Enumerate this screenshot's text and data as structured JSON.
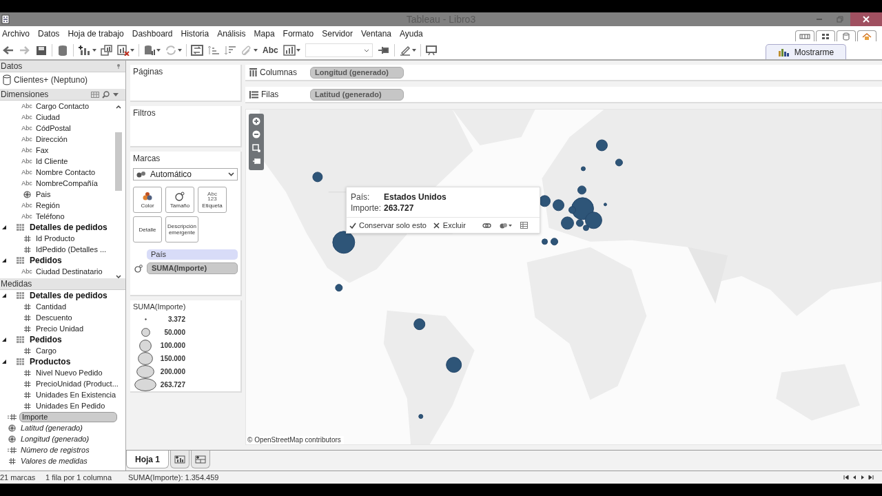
{
  "window": {
    "title": "Tableau - Libro3"
  },
  "menu": [
    "Archivo",
    "Datos",
    "Hoja de trabajo",
    "Dashboard",
    "Historia",
    "Análisis",
    "Mapa",
    "Formato",
    "Servidor",
    "Ventana",
    "Ayuda"
  ],
  "toolbar": {
    "text_button": "Abc"
  },
  "show_me": {
    "label": "Mostrarme"
  },
  "data_pane": {
    "title": "Datos",
    "source": "Clientes+ (Neptuno)",
    "dimensions": {
      "title": "Dimensiones",
      "items": [
        {
          "kind": "abc",
          "type_label": "Abc",
          "label": "Cargo Contacto"
        },
        {
          "kind": "abc",
          "type_label": "Abc",
          "label": "Ciudad"
        },
        {
          "kind": "abc",
          "type_label": "Abc",
          "label": "CódPostal"
        },
        {
          "kind": "abc",
          "type_label": "Abc",
          "label": "Dirección"
        },
        {
          "kind": "abc",
          "type_label": "Abc",
          "label": "Fax"
        },
        {
          "kind": "abc",
          "type_label": "Abc",
          "label": "Id Cliente"
        },
        {
          "kind": "abc",
          "type_label": "Abc",
          "label": "Nombre Contacto"
        },
        {
          "kind": "abc",
          "type_label": "Abc",
          "label": "NombreCompañía"
        },
        {
          "kind": "geo",
          "label": "Pais"
        },
        {
          "kind": "abc",
          "type_label": "Abc",
          "label": "Región"
        },
        {
          "kind": "abc",
          "type_label": "Abc",
          "label": "Teléfono"
        },
        {
          "kind": "group",
          "label": "Detalles de pedidos",
          "expanded": true,
          "children": [
            {
              "kind": "num",
              "label": "Id Producto"
            },
            {
              "kind": "num",
              "label": "IdPedido (Detalles ..."
            }
          ]
        },
        {
          "kind": "group",
          "label": "Pedidos",
          "expanded": true,
          "children": [
            {
              "kind": "abc",
              "type_label": "Abc",
              "label": "Ciudad Destinatario"
            }
          ]
        }
      ]
    },
    "measures": {
      "title": "Medidas",
      "items": [
        {
          "kind": "group",
          "label": "Detalles de pedidos",
          "expanded": true,
          "children": [
            {
              "kind": "num",
              "label": "Cantidad"
            },
            {
              "kind": "num",
              "label": "Descuento"
            },
            {
              "kind": "num",
              "label": "Precio Unidad"
            }
          ]
        },
        {
          "kind": "group",
          "label": "Pedidos",
          "expanded": true,
          "children": [
            {
              "kind": "num",
              "label": "Cargo"
            }
          ]
        },
        {
          "kind": "group",
          "label": "Productos",
          "expanded": true,
          "children": [
            {
              "kind": "num",
              "label": "Nivel Nuevo Pedido"
            },
            {
              "kind": "num",
              "label": "PrecioUnidad (Product..."
            },
            {
              "kind": "num",
              "label": "Unidades En Existencia"
            },
            {
              "kind": "num",
              "label": "Unidades En Pedido"
            }
          ]
        },
        {
          "kind": "calc",
          "label": "Importe",
          "selected": true,
          "generated": false
        },
        {
          "kind": "geo",
          "label": "Latitud (generado)",
          "selected": false,
          "generated": true
        },
        {
          "kind": "geo",
          "label": "Longitud (generado)",
          "selected": false,
          "generated": true
        },
        {
          "kind": "calc",
          "label": "Número de registros",
          "selected": false,
          "generated": true
        },
        {
          "kind": "num",
          "label": "Valores de medidas",
          "selected": false,
          "generated": true
        }
      ]
    }
  },
  "cards": {
    "pages": {
      "title": "Páginas"
    },
    "filters": {
      "title": "Filtros"
    },
    "marks": {
      "title": "Marcas",
      "mark_type": "Automático",
      "buttons": [
        {
          "kind": "color",
          "label": "Color"
        },
        {
          "kind": "size",
          "label": "Tamaño"
        },
        {
          "kind": "label",
          "label": "Etiqueta",
          "icon_text": [
            "Abc",
            "123"
          ]
        },
        {
          "kind": "detail",
          "label": "Detalle"
        },
        {
          "kind": "tooltip",
          "label": "Descripción emergente"
        }
      ],
      "fields": [
        {
          "kind": "detail",
          "label": "País"
        },
        {
          "kind": "size",
          "label": "SUMA(Importe)"
        }
      ]
    },
    "legend": {
      "title": "SUMA(Importe)",
      "items": [
        "3.372",
        "50.000",
        "100.000",
        "150.000",
        "200.000",
        "263.727"
      ]
    }
  },
  "shelves": [
    {
      "kind": "columns",
      "label": "Columnas",
      "pill": "Longitud (generado)"
    },
    {
      "kind": "rows",
      "label": "Filas",
      "pill": "Latitud (generado)"
    }
  ],
  "map": {
    "tooltip": {
      "rows": [
        {
          "label": "País:",
          "value": "Estados Unidos"
        },
        {
          "label": "Importe:",
          "value": "263.727"
        }
      ],
      "actions": [
        {
          "kind": "keep",
          "label": "Conservar solo esto"
        },
        {
          "kind": "exclude",
          "label": "Excluir"
        }
      ]
    },
    "attribution": "© OpenStreetMap contributors"
  },
  "sheet_tabs": [
    {
      "label": "Hoja 1",
      "selected": true
    }
  ],
  "status_bar": [
    "21 marcas",
    "1 fila por 1 columna",
    "SUMA(Importe): 1.354.459"
  ]
}
